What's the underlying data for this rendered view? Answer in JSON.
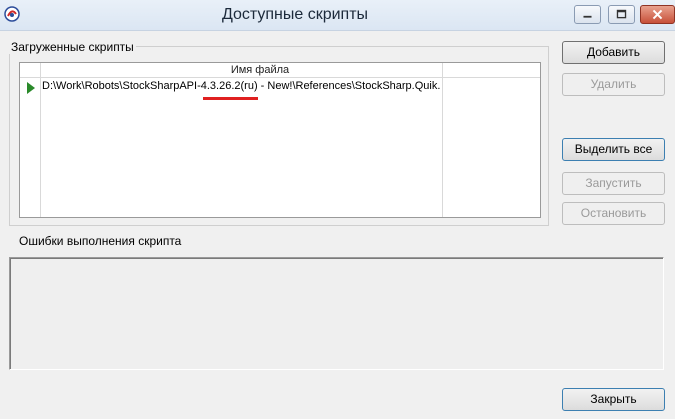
{
  "window": {
    "title": "Доступные скрипты",
    "icon": "app-icon"
  },
  "loaded_scripts": {
    "group_label": "Загруженные скрипты",
    "column_header": "Имя файла",
    "rows": [
      {
        "file": "D:\\Work\\Robots\\StockSharpAPI-4.3.26.2(ru) - New!\\References\\StockSharp.Quik."
      }
    ]
  },
  "buttons": {
    "add": "Добавить",
    "delete": "Удалить",
    "select_all": "Выделить все",
    "run": "Запустить",
    "stop": "Остановить",
    "close": "Закрыть"
  },
  "errors": {
    "label": "Ошибки выполнения скрипта"
  },
  "colors": {
    "run_arrow": "#2a8a2a",
    "highlight_underline": "#e02020"
  }
}
